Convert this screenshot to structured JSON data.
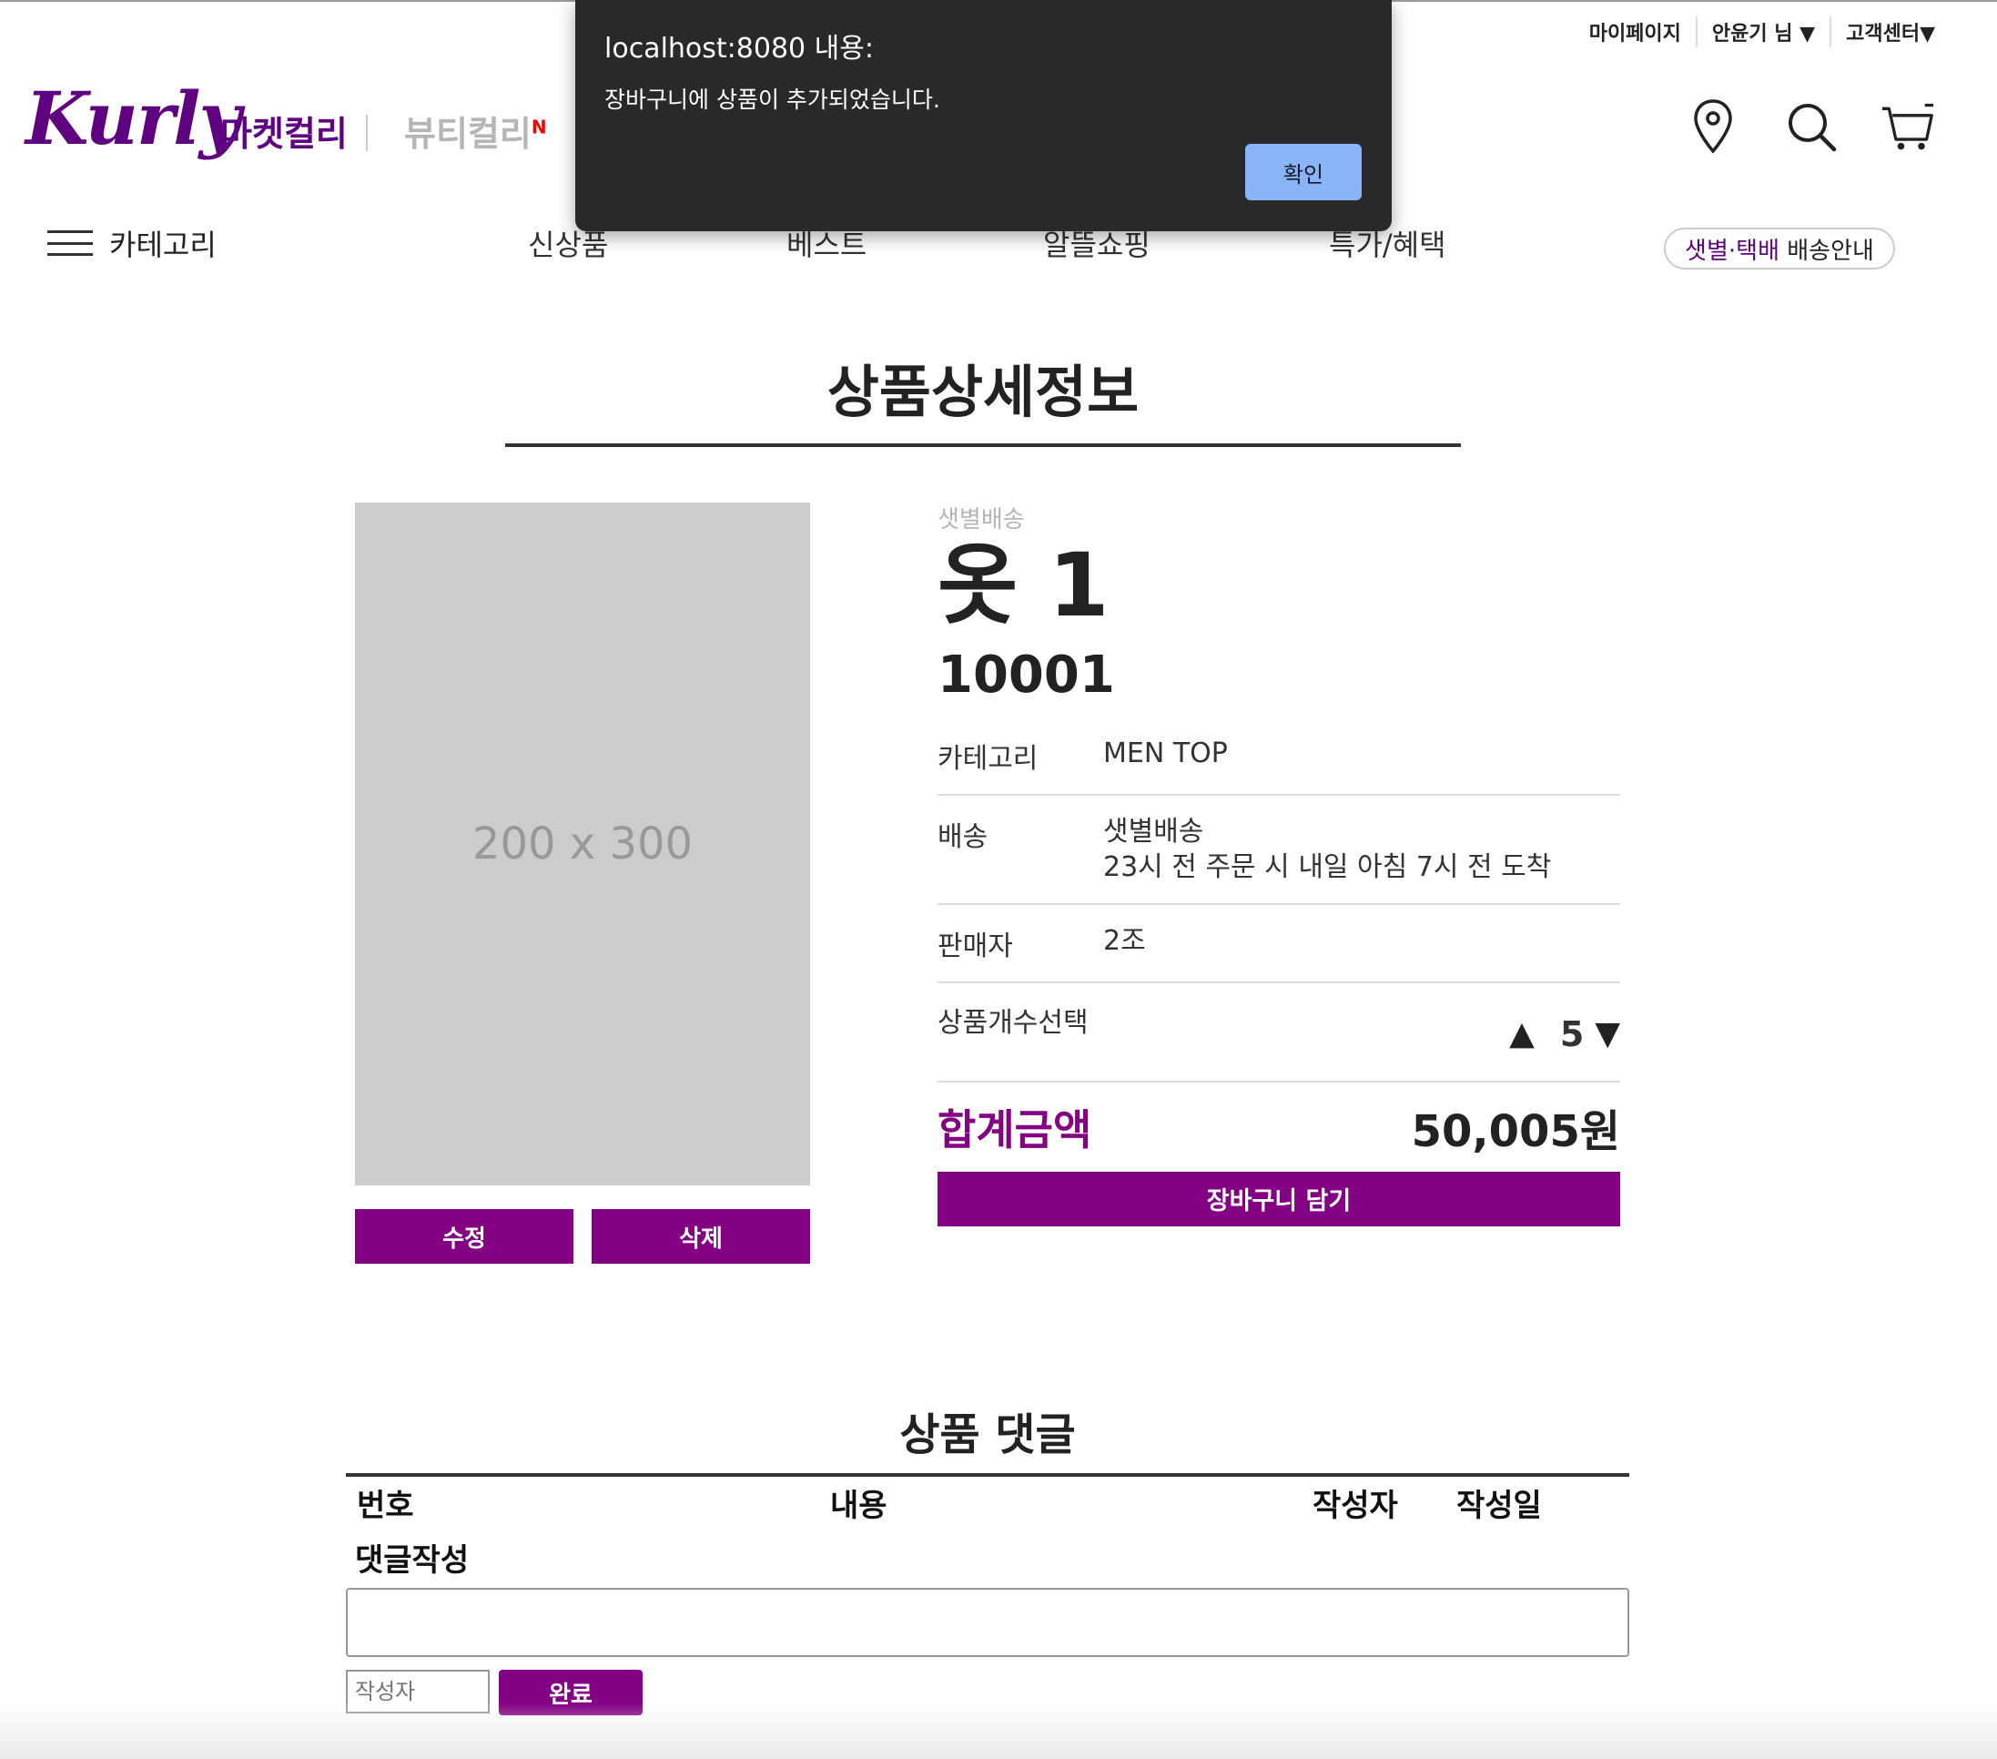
{
  "header": {
    "user_menu": [
      "마이페이지",
      "안윤기 님 ▼",
      "고객센터▼"
    ],
    "logo_text": "Kurly",
    "tabs": {
      "market": "마켓컬리",
      "beauty": "뷰티컬리",
      "beauty_badge": "N"
    },
    "icons": [
      "location-icon",
      "search-icon",
      "cart-icon"
    ]
  },
  "nav": {
    "category": "카테고리",
    "items": [
      "신상품",
      "베스트",
      "알뜰쇼핑",
      "특가/혜택"
    ],
    "delivery_highlight": "샛별·택배",
    "delivery_rest": " 배송안내"
  },
  "page": {
    "title": "상품상세정보"
  },
  "product": {
    "image_placeholder": "200 x 300",
    "delivery_tag": "샛별배송",
    "name": "옷 1",
    "price": "10001",
    "rows": {
      "category_label": "카테고리",
      "category_value": "MEN TOP",
      "delivery_label": "배송",
      "delivery_value_1": "샛별배송",
      "delivery_value_2": "23시 전 주문 시 내일 아침 7시 전 도착",
      "seller_label": "판매자",
      "seller_value": "2조",
      "qty_label": "상품개수선택",
      "qty_up": "▲",
      "qty_value": "5",
      "qty_down": "▼"
    },
    "total_label": "합계금액",
    "total_value": "50,005원",
    "cart_button": "장바구니 담기",
    "edit_button": "수정",
    "delete_button": "삭제"
  },
  "comments": {
    "title": "상품 댓글",
    "columns": [
      "번호",
      "내용",
      "작성자",
      "작성일"
    ],
    "write_label": "댓글작성",
    "author_placeholder": "작성자",
    "submit": "완료"
  },
  "alert": {
    "title": "localhost:8080 내용:",
    "message": "장바구니에 상품이 추가되었습니다.",
    "ok": "확인"
  },
  "colors": {
    "brand": "#5f0080",
    "button": "#830083",
    "alert_bg": "#29292b",
    "alert_button": "#8ab4f8"
  }
}
